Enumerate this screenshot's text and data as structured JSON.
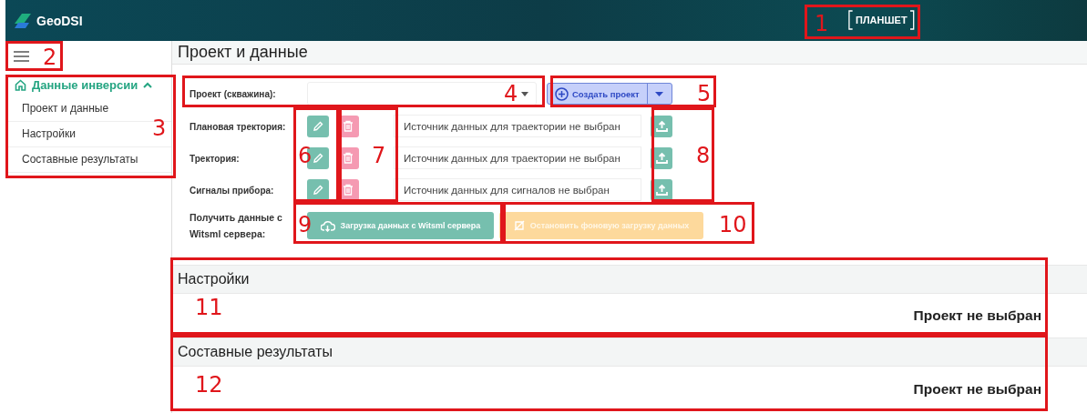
{
  "header": {
    "logo_text": "GeoDSI",
    "mode_button": "ПЛАНШЕТ"
  },
  "sidebar": {
    "group": {
      "label": "Данные инверсии",
      "expanded": true,
      "items": [
        {
          "label": "Проект и данные"
        },
        {
          "label": "Настройки"
        },
        {
          "label": "Составные результаты"
        }
      ]
    }
  },
  "page_title": "Проект и данные",
  "project": {
    "label": "Проект (скважина):",
    "create_button": "Создать проект"
  },
  "sources": [
    {
      "label": "Плановая тректория:",
      "placeholder": "Источник данных для траектории не выбран"
    },
    {
      "label": "Тректория:",
      "placeholder": "Источник данных для траектории не выбран"
    },
    {
      "label": "Сигналы прибора:",
      "placeholder": "Источник данных для сигналов не выбран"
    }
  ],
  "witsml": {
    "label": "Получить данные с Witsml сервера:",
    "load_button": "Загрузка данных с Witsml сервера",
    "stop_button": {
      "label": "Остановить фоновую загрузку данных",
      "disabled": true
    }
  },
  "sections": [
    {
      "title": "Настройки",
      "message": "Проект не выбран"
    },
    {
      "title": "Составные результаты",
      "message": "Проект не выбран"
    }
  ],
  "annotations": [
    {
      "number": "1"
    },
    {
      "number": "2"
    },
    {
      "number": "3"
    },
    {
      "number": "4"
    },
    {
      "number": "5"
    },
    {
      "number": "6"
    },
    {
      "number": "7"
    },
    {
      "number": "8"
    },
    {
      "number": "9"
    },
    {
      "number": "10"
    },
    {
      "number": "11"
    },
    {
      "number": "12"
    }
  ]
}
